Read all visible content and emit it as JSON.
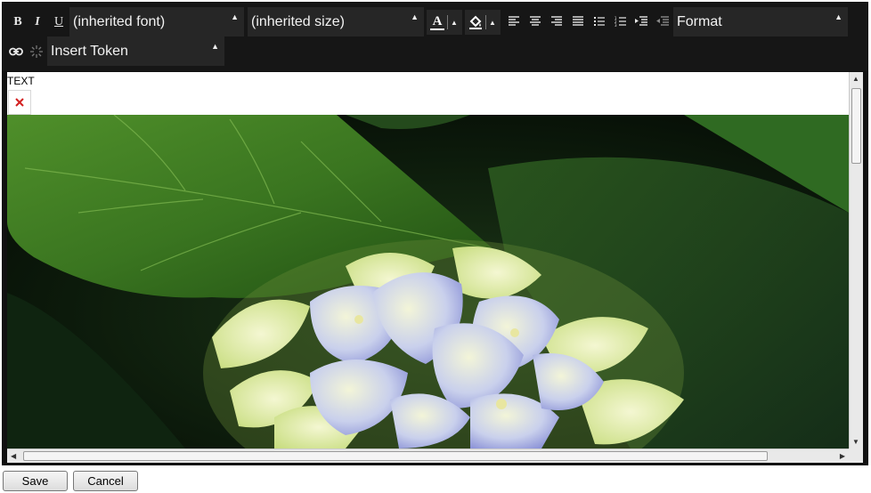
{
  "toolbar": {
    "bold_label": "B",
    "italic_label": "I",
    "underline_label": "U",
    "font_select": {
      "value": "(inherited font)"
    },
    "size_select": {
      "value": "(inherited size)"
    },
    "format_select": {
      "value": "Format"
    },
    "token_select": {
      "value": "Insert Token"
    },
    "text_color_label": "A",
    "icons": [
      "bold",
      "italic",
      "underline",
      "text-color",
      "background-color",
      "align-left",
      "align-center",
      "align-right",
      "justify",
      "unordered-list",
      "ordered-list",
      "indent",
      "outdent",
      "link",
      "unlink"
    ]
  },
  "content": {
    "text": "TEXT",
    "broken_image_icon": "broken-image-icon",
    "photo_description_icon": "hydrangea-photo"
  },
  "actions": {
    "save_label": "Save",
    "cancel_label": "Cancel"
  },
  "colors": {
    "toolbar_bg": "#161616",
    "dropdown_bg": "#262626",
    "toolbar_text": "#e8e8e8"
  }
}
